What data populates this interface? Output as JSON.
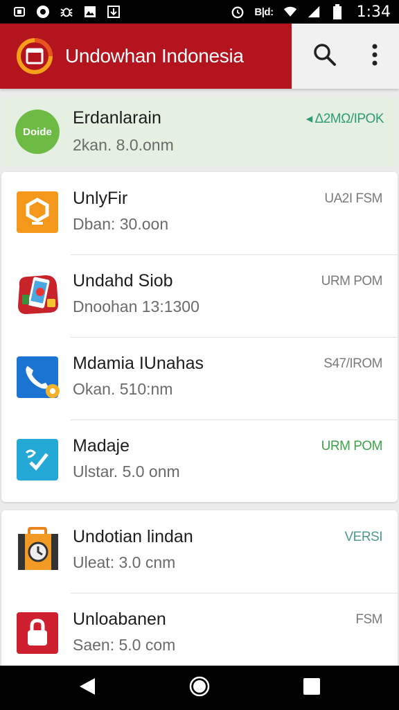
{
  "status_bar": {
    "time": "1:34",
    "carrier_text": "B|d:",
    "left_icons": [
      "screenshot-icon",
      "circle-notification-icon",
      "bug-icon",
      "image-icon",
      "download-icon"
    ],
    "right_icons": [
      "alarm-icon",
      "wifi-icon",
      "signal-icon",
      "battery-icon"
    ]
  },
  "app_bar": {
    "title": "Undowhan Indonesia",
    "accent_color": "#b3141d",
    "actions": [
      "search-icon",
      "more-vert-icon"
    ]
  },
  "highlight_item": {
    "avatar_text": "Doide",
    "name": "Erdanlarain",
    "subtitle": "2kan. 8.0.onm",
    "tag": "◂ Δ2MΩ/IPOK",
    "tag_color": "#2e9c76",
    "background": "#e6f0e2"
  },
  "card1": {
    "items": [
      {
        "name": "UnlyFir",
        "subtitle": "Dban: 30.oon",
        "tag": "UA2I FSM",
        "icon": "orange-hexagon-icon"
      },
      {
        "name": "Undahd Siob",
        "subtitle": "Dnoohan 13:1300",
        "tag": "URM POM",
        "icon": "red-phone-app-icon"
      },
      {
        "name": "Mdamia IUnahas",
        "subtitle": "Okan. 510:nm",
        "tag": "S47/IROM",
        "icon": "blue-phone-icon"
      },
      {
        "name": "Madaje",
        "subtitle": "Ulstar. 5.0 onm",
        "tag": "URM POM",
        "icon": "cyan-check-icon",
        "tag_color": "#3ea34a"
      }
    ]
  },
  "card2": {
    "items": [
      {
        "name": "Undotian lindan",
        "subtitle": "Uleat: 3.0 cnm",
        "tag": "VERSI",
        "icon": "orange-suitcase-icon",
        "tag_color": "#4c9a8c"
      },
      {
        "name": "Unloabanen",
        "subtitle": "Saen: 5.0 com",
        "tag": "FSM",
        "icon": "red-lock-icon"
      }
    ]
  },
  "nav_bar": {
    "buttons": [
      "back-icon",
      "home-icon",
      "recents-icon"
    ]
  }
}
